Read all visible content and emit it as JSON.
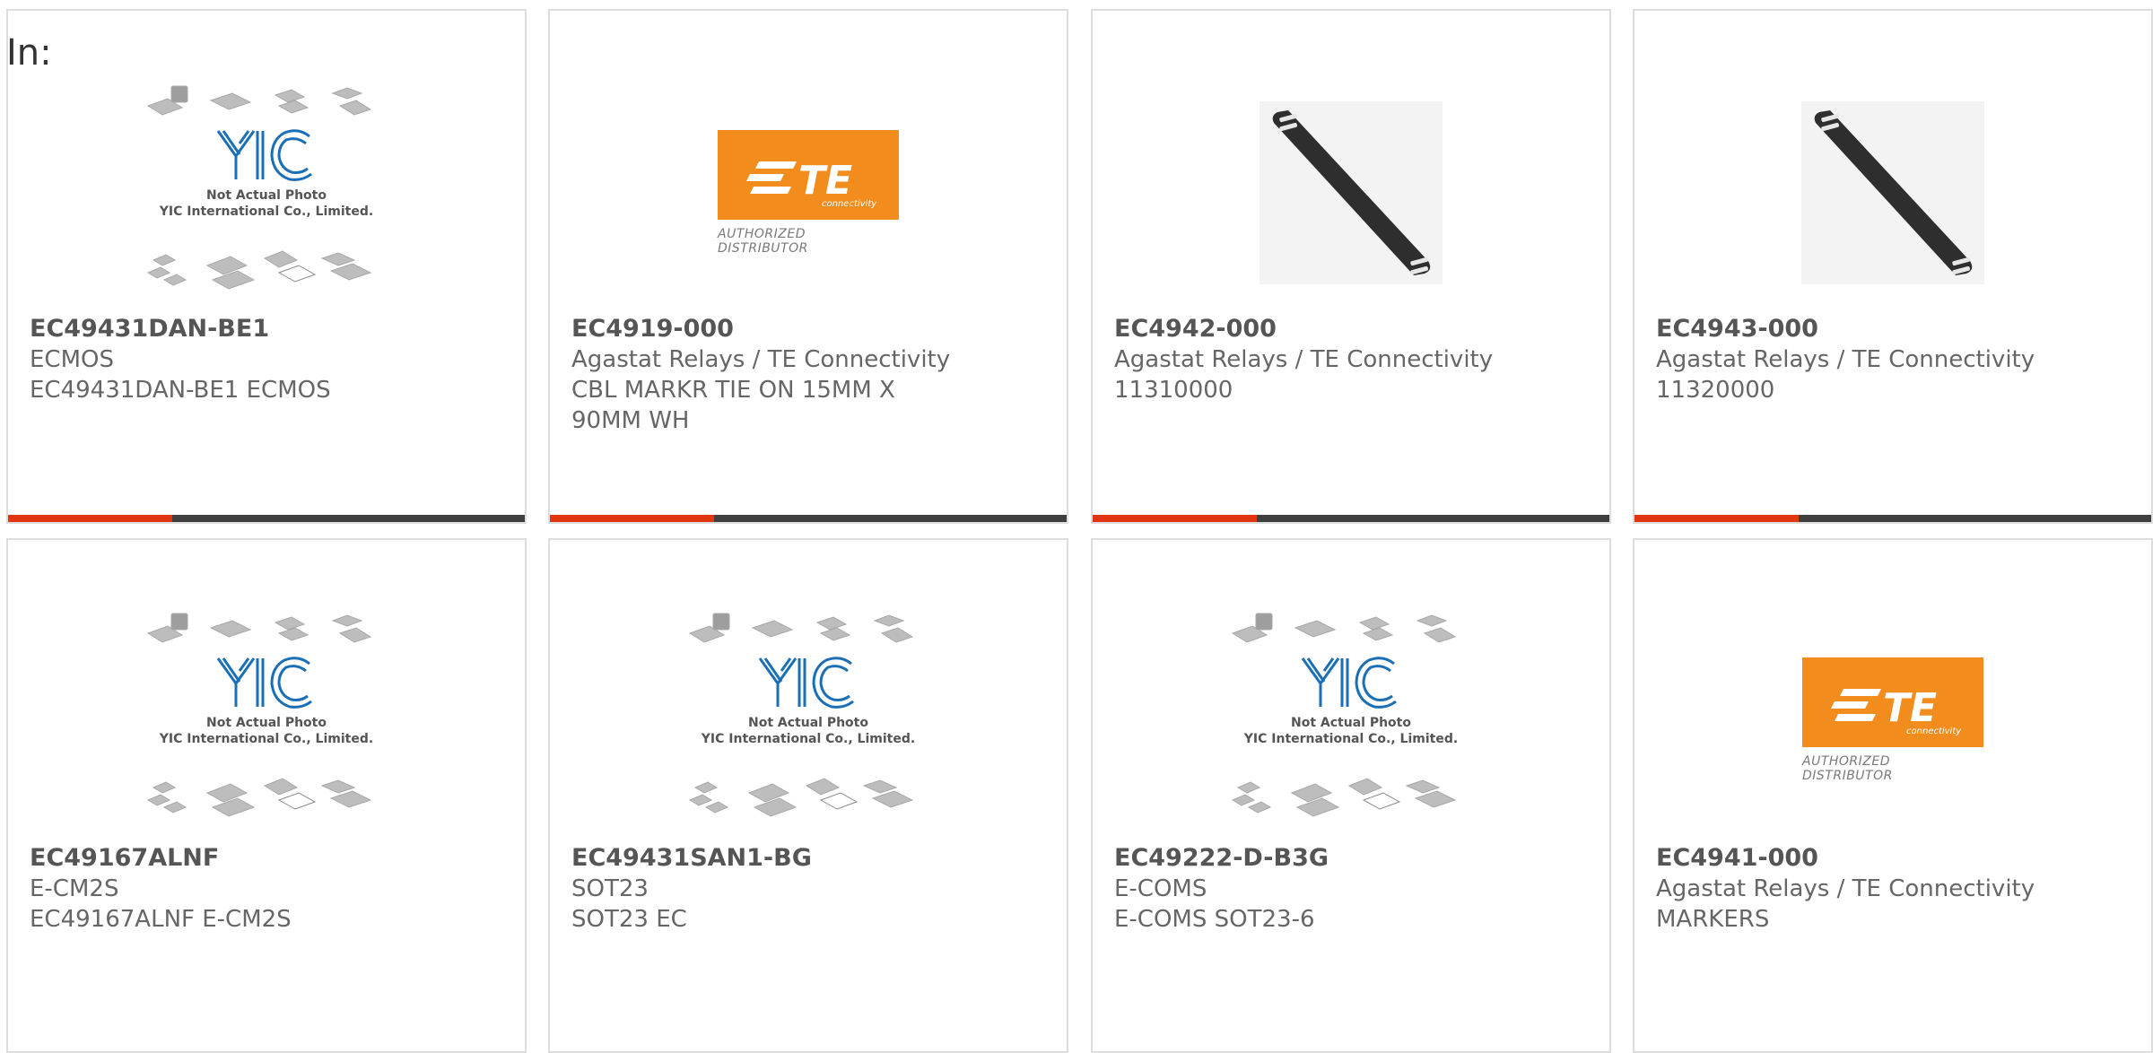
{
  "page_label": "In:",
  "placeholder_image": {
    "line1": "Not Actual Photo",
    "line2": "YIC International Co., Limited.",
    "logo_text": "YIC"
  },
  "te_logo": {
    "text": "TE",
    "sub_text": "connectivity",
    "caption": "AUTHORIZED DISTRIBUTOR"
  },
  "colors": {
    "accent_red": "#e1360f",
    "bar_dark": "#3f3f3f",
    "te_orange": "#f28c1d",
    "yic_blue": "#1a6fb5"
  },
  "products": [
    {
      "part_number": "EC49431DAN-BE1",
      "manufacturer": "ECMOS",
      "description": "EC49431DAN-BE1 ECMOS",
      "image": "yic-placeholder"
    },
    {
      "part_number": "EC4919-000",
      "manufacturer": "Agastat Relays / TE Connectivity",
      "description": "CBL MARKR TIE ON 15MM X 90MM WH",
      "image": "te-logo"
    },
    {
      "part_number": "EC4942-000",
      "manufacturer": "Agastat Relays / TE Connectivity",
      "description": "11310000",
      "image": "cable-marker-strap"
    },
    {
      "part_number": "EC4943-000",
      "manufacturer": "Agastat Relays / TE Connectivity",
      "description": "11320000",
      "image": "cable-marker-strap"
    },
    {
      "part_number": "EC49167ALNF",
      "manufacturer": "E-CM2S",
      "description": "EC49167ALNF E-CM2S",
      "image": "yic-placeholder"
    },
    {
      "part_number": "EC49431SAN1-BG",
      "manufacturer": "SOT23",
      "description": "SOT23 EC",
      "image": "yic-placeholder"
    },
    {
      "part_number": "EC49222-D-B3G",
      "manufacturer": "E-COMS",
      "description": "E-COMS SOT23-6",
      "image": "yic-placeholder"
    },
    {
      "part_number": "EC4941-000",
      "manufacturer": "Agastat Relays / TE Connectivity",
      "description": "MARKERS",
      "image": "te-logo"
    }
  ]
}
